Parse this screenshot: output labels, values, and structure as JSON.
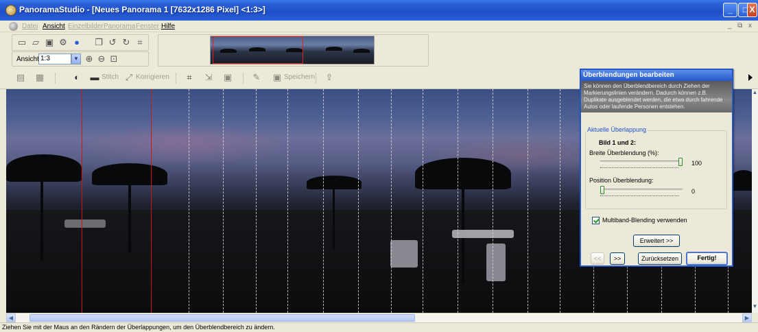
{
  "window": {
    "title": "PanoramaStudio - [Neues Panorama 1 [7632x1286 Pixel] <1:3>]",
    "minimize_glyph": "_",
    "maximize_glyph": "□",
    "close_glyph": "X"
  },
  "menu": {
    "items": [
      {
        "label": "Datei",
        "enabled": false
      },
      {
        "label": "Ansicht",
        "enabled": true
      },
      {
        "label": "Einzelbilder",
        "enabled": false
      },
      {
        "label": "Panorama",
        "enabled": false
      },
      {
        "label": "Fenster",
        "enabled": false
      },
      {
        "label": "Hilfe",
        "enabled": true
      }
    ],
    "mdi_controls": "_ ⧉ x"
  },
  "toolbar": {
    "view_label": "Ansicht:",
    "view_value": "1:3"
  },
  "toolbar2": {
    "stitch_label": "Stitch",
    "correct_label": "Korrigieren",
    "save_label": "Speichern"
  },
  "dialog": {
    "title": "Überblendungen bearbeiten",
    "description": "Sie können den Überblendbereich durch Ziehen der Markierungslinien verändern. Dadurch können z.B. Duplikate ausgeblendet werden, die etwa durch fahrende Autos oder laufende Personen entstehen.",
    "group_title": "Aktuelle Überlappung",
    "image_pair": "Bild 1 und 2:",
    "width_label": "Breite Überblendung (%):",
    "width_value": "100",
    "width_fraction": 1.0,
    "position_label": "Position Überblendung:",
    "position_value": "0",
    "position_fraction": 0.0,
    "multiband_label": "Multiband-Blending verwenden",
    "multiband_checked": true,
    "extended_button": "Erweitert >>",
    "prev_button": "<<",
    "next_button": ">>",
    "reset_button": "Zurücksetzen",
    "done_button": "Fertig!"
  },
  "status": {
    "text": "Ziehen Sie mit der Maus an den Rändern der Überlappungen, um den Überblendbereich zu ändern."
  },
  "colors": {
    "titlebar": "#2456c8",
    "selection_line": "#c81818",
    "accent_text": "#1f53c9"
  }
}
